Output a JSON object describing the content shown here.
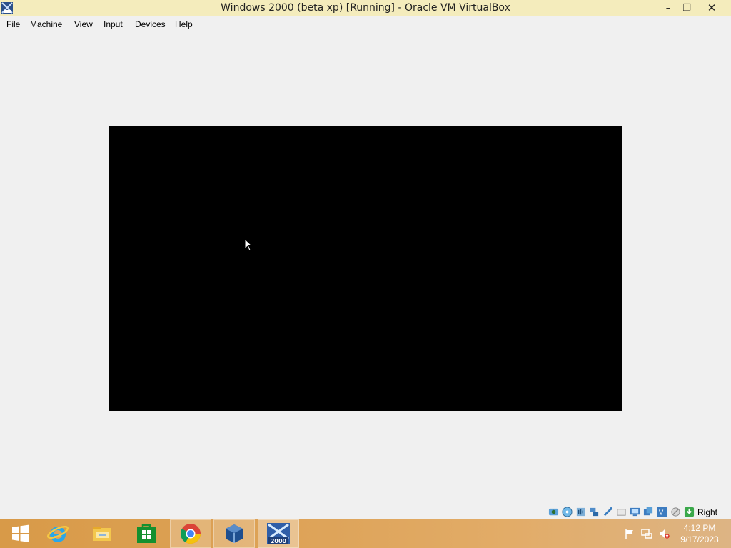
{
  "window": {
    "title": "Windows 2000 (beta xp) [Running] - Oracle VM VirtualBox",
    "controls": {
      "minimize": "–",
      "maximize": "❐",
      "close": "✕"
    }
  },
  "menu": {
    "items": [
      {
        "label": "File"
      },
      {
        "label": "Machine"
      },
      {
        "label": "View"
      },
      {
        "label": "Input"
      },
      {
        "label": "Devices"
      },
      {
        "label": "Help"
      }
    ]
  },
  "vm": {
    "screen_color": "#000000"
  },
  "statusbar": {
    "icons": [
      "hard-disk-icon",
      "optical-drive-icon",
      "audio-icon",
      "network-icon",
      "usb-icon",
      "shared-folders-icon",
      "display-icon",
      "recording-icon",
      "cpu-icon",
      "mouse-integration-icon",
      "keyboard-capture-icon"
    ],
    "host_key": "Right Ctrl"
  },
  "taskbar": {
    "apps": [
      "start-icon",
      "internet-explorer-icon",
      "file-explorer-icon",
      "store-icon",
      "chrome-icon",
      "virtualbox-icon",
      "windows-2000-vm-icon"
    ],
    "vm_badge": "2000",
    "tray": [
      "action-center-flag-icon",
      "network-tray-icon",
      "volume-muted-icon"
    ],
    "time": "4:12 PM",
    "date": "9/17/2023"
  },
  "colors": {
    "titlebar": "#f4ecbc",
    "taskbar": "#dea45a",
    "background": "#f0f0f0"
  }
}
